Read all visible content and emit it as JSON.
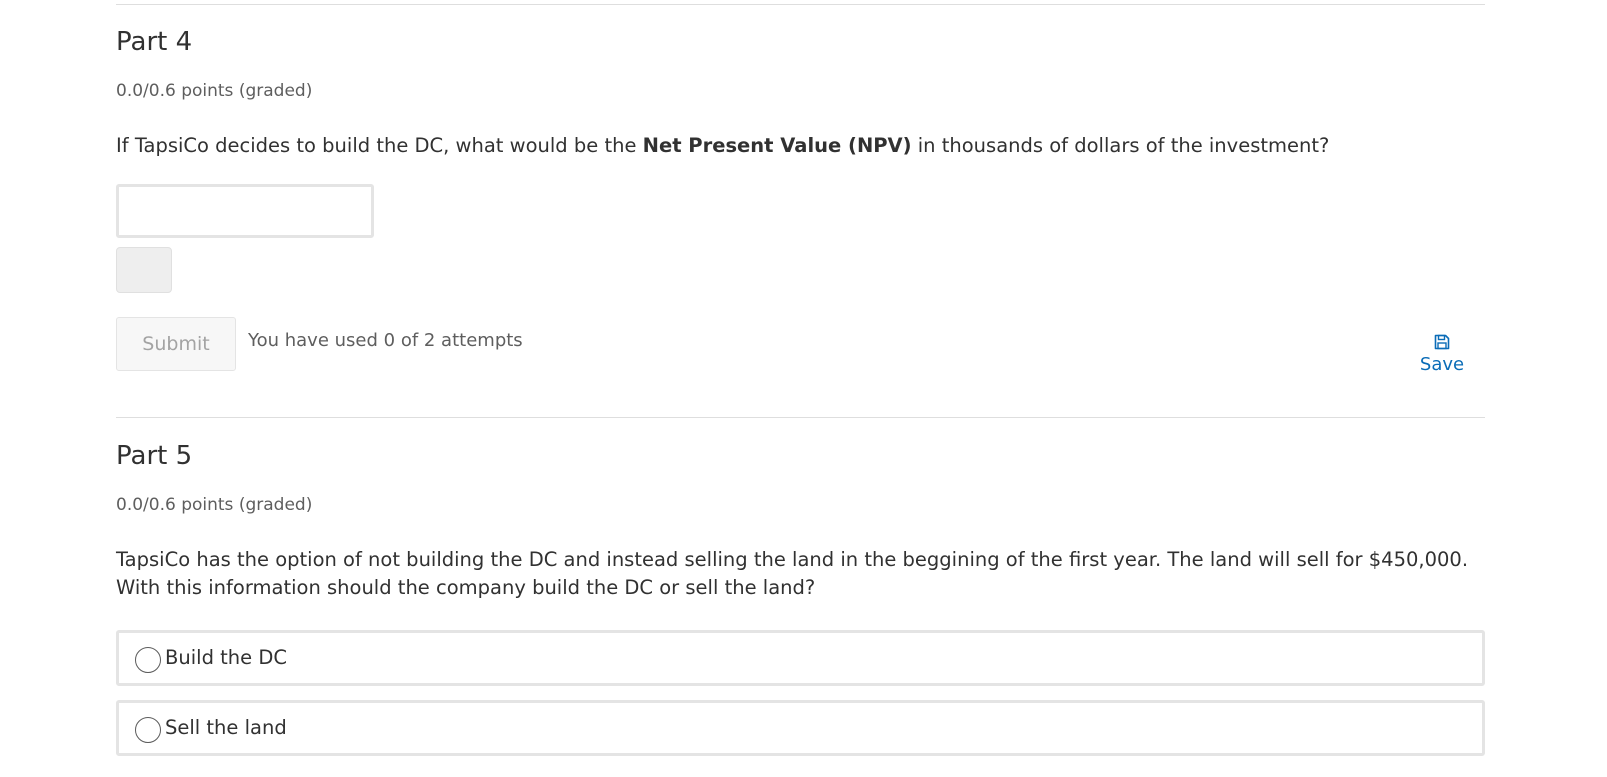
{
  "part4": {
    "title": "Part 4",
    "points": "0.0/0.6 points (graded)",
    "question_before": "If TapsiCo decides to build the DC, what would be the ",
    "question_bold": "Net Present Value (NPV)",
    "question_after": " in thousands of dollars of the investment?",
    "answer_value": "",
    "submit_label": "Submit",
    "attempts_text": "You have used 0 of 2 attempts",
    "save_label": "Save",
    "save_icon": "floppy-disk-icon"
  },
  "part5": {
    "title": "Part 5",
    "points": "0.0/0.6 points (graded)",
    "question": "TapsiCo has the option of not building the DC and instead selling the land in the beggining of the first year. The land will sell for $450,000. With this information should the company build the DC or sell the land?",
    "choices": [
      {
        "label": "Build the DC",
        "selected": false
      },
      {
        "label": "Sell the land",
        "selected": false
      }
    ]
  },
  "colors": {
    "text": "#313131",
    "muted": "#5e5e5e",
    "link": "#0a6cb7",
    "border": "#e4e4e4"
  }
}
